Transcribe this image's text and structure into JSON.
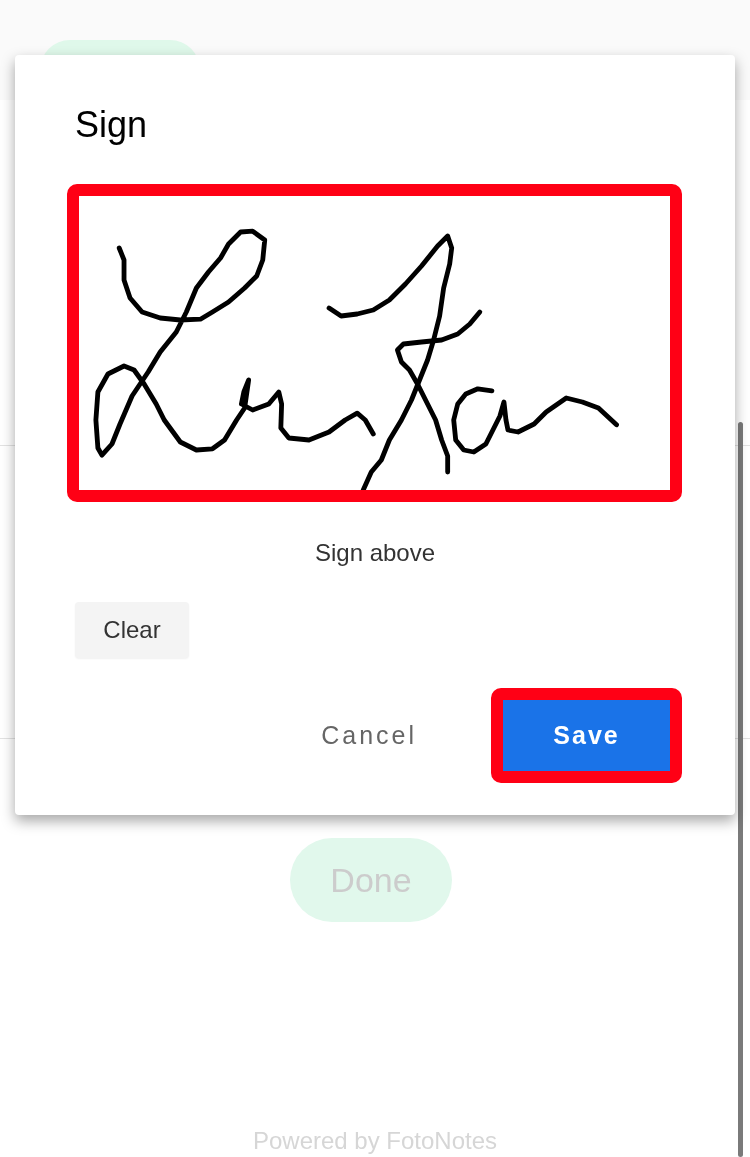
{
  "dialog": {
    "title": "Sign",
    "signature_pad": {
      "highlighted": true,
      "signed": true
    },
    "hint": "Sign above",
    "clear_button": "Clear",
    "buttons": [
      {
        "label": "Cancel",
        "kind": "text",
        "highlighted": false
      },
      {
        "label": "Save",
        "kind": "primary",
        "highlighted": true
      }
    ]
  },
  "page": {
    "done_button": {
      "label": "Done",
      "disabled": true
    },
    "footer": "Powered by FotoNotes"
  }
}
